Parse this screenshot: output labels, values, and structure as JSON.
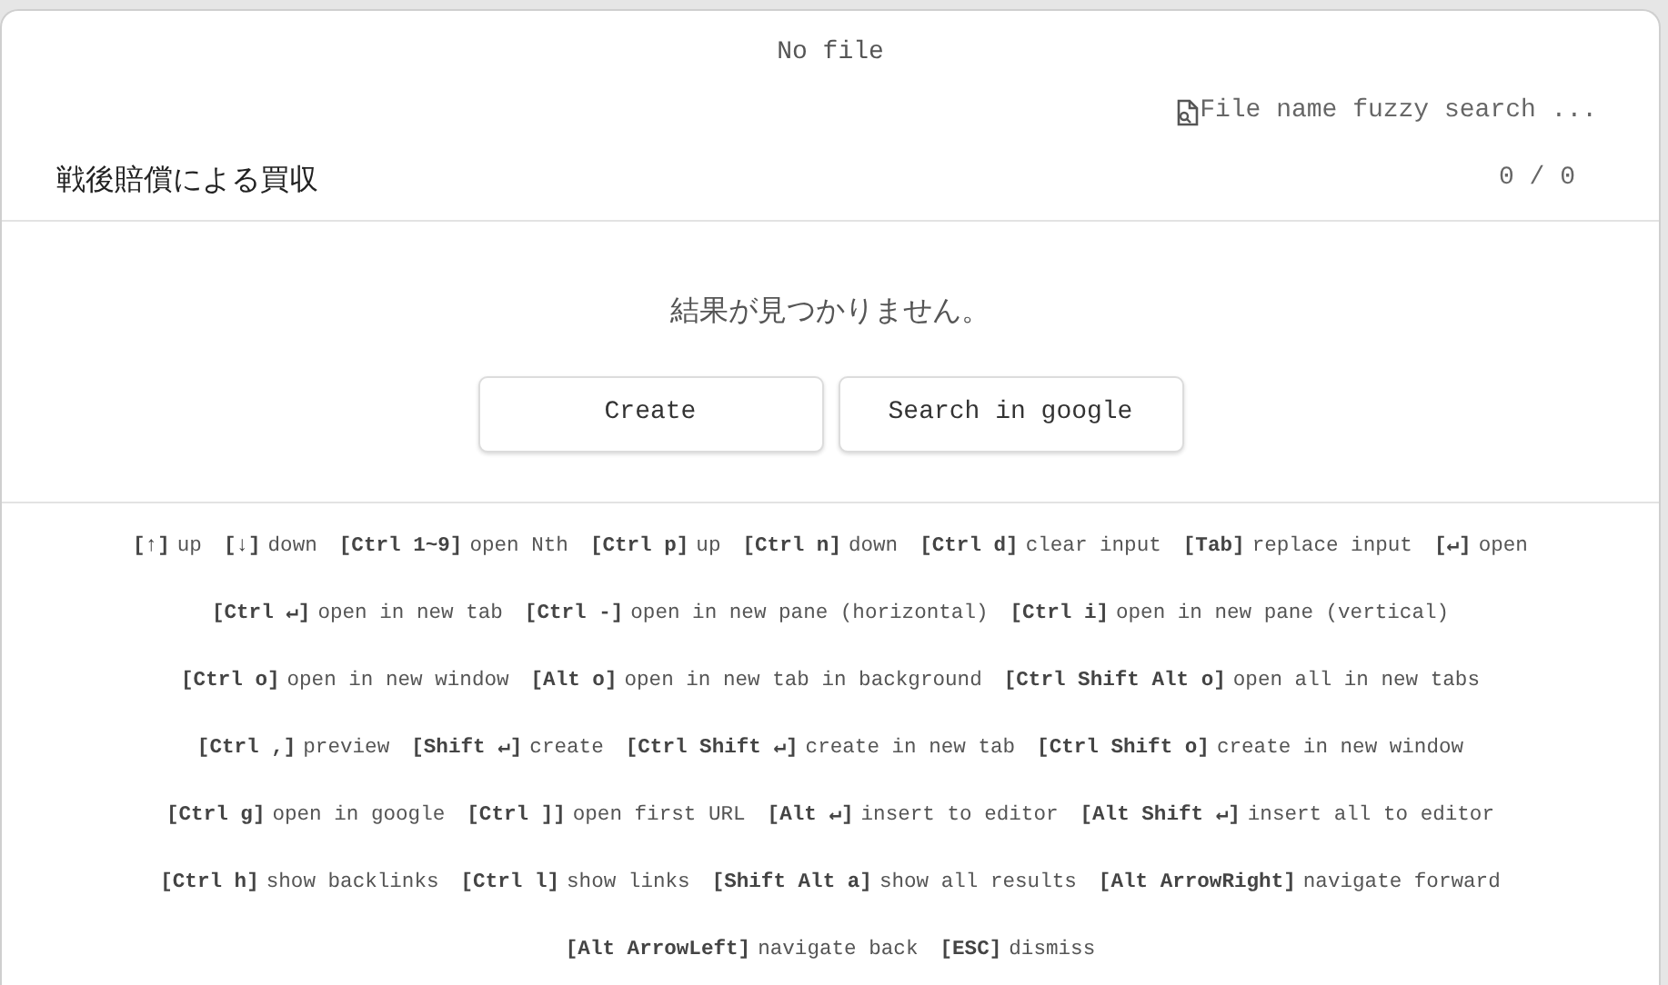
{
  "header": {
    "title": "No file"
  },
  "search_hint": {
    "text": "File name fuzzy search ..."
  },
  "search": {
    "value": "戦後賠償による買収",
    "counter": "0 / 0"
  },
  "results": {
    "message": "結果が見つかりません。"
  },
  "buttons": [
    "Create",
    "Search in google"
  ],
  "instruction_lines": [
    [
      {
        "key": "[↑]",
        "desc": "up"
      },
      {
        "key": "[↓]",
        "desc": "down"
      },
      {
        "key": "[Ctrl 1~9]",
        "desc": "open Nth"
      },
      {
        "key": "[Ctrl p]",
        "desc": "up"
      },
      {
        "key": "[Ctrl n]",
        "desc": "down"
      },
      {
        "key": "[Ctrl d]",
        "desc": "clear input"
      },
      {
        "key": "[Tab]",
        "desc": "replace input"
      },
      {
        "key": "[↵]",
        "desc": "open"
      }
    ],
    [
      {
        "key": "[Ctrl ↵]",
        "desc": "open in new tab"
      },
      {
        "key": "[Ctrl -]",
        "desc": "open in new pane (horizontal)"
      },
      {
        "key": "[Ctrl i]",
        "desc": "open in new pane (vertical)"
      }
    ],
    [
      {
        "key": "[Ctrl o]",
        "desc": "open in new window"
      },
      {
        "key": "[Alt o]",
        "desc": "open in new tab in background"
      },
      {
        "key": "[Ctrl Shift Alt o]",
        "desc": "open all in new tabs"
      }
    ],
    [
      {
        "key": "[Ctrl ,]",
        "desc": "preview"
      },
      {
        "key": "[Shift ↵]",
        "desc": "create"
      },
      {
        "key": "[Ctrl Shift ↵]",
        "desc": "create in new tab"
      },
      {
        "key": "[Ctrl Shift o]",
        "desc": "create in new window"
      }
    ],
    [
      {
        "key": "[Ctrl g]",
        "desc": "open in google"
      },
      {
        "key": "[Ctrl ]]",
        "desc": "open first URL"
      },
      {
        "key": "[Alt ↵]",
        "desc": "insert to editor"
      },
      {
        "key": "[Alt Shift ↵]",
        "desc": "insert all to editor"
      }
    ],
    [
      {
        "key": "[Ctrl h]",
        "desc": "show backlinks"
      },
      {
        "key": "[Ctrl l]",
        "desc": "show links"
      },
      {
        "key": "[Shift Alt a]",
        "desc": "show all results"
      },
      {
        "key": "[Alt ArrowRight]",
        "desc": "navigate forward"
      }
    ],
    [
      {
        "key": "[Alt ArrowLeft]",
        "desc": "navigate back"
      },
      {
        "key": "[ESC]",
        "desc": "dismiss"
      }
    ]
  ]
}
